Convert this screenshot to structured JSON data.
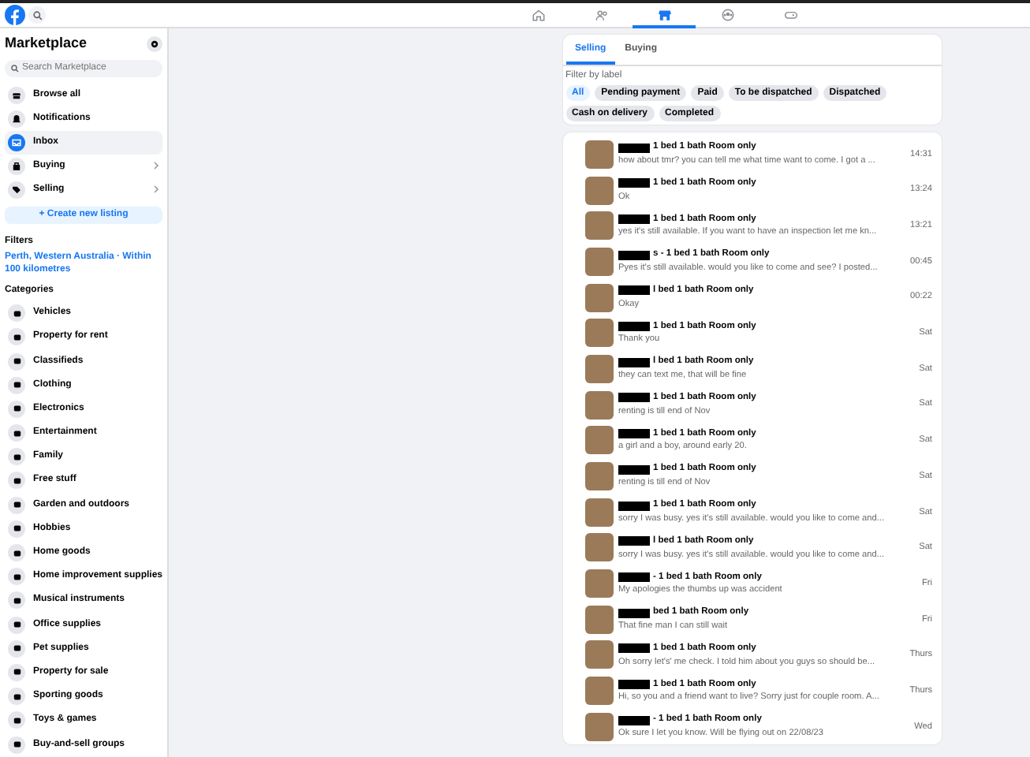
{
  "top_nav": [
    {
      "kind": "home",
      "selected": false
    },
    {
      "kind": "friends",
      "selected": false
    },
    {
      "kind": "marketplace",
      "selected": true
    },
    {
      "kind": "groups",
      "selected": false
    },
    {
      "kind": "gaming",
      "selected": false
    }
  ],
  "sidebar": {
    "title": "Marketplace",
    "search": {
      "placeholder": "Search Marketplace"
    },
    "items": [
      {
        "kind": "shop",
        "label": "Browse all",
        "selected": false,
        "has_arrow": false
      },
      {
        "kind": "bell",
        "label": "Notifications",
        "selected": false,
        "has_arrow": false
      },
      {
        "kind": "inbox",
        "label": "Inbox",
        "selected": true,
        "has_arrow": false
      },
      {
        "kind": "bag",
        "label": "Buying",
        "selected": false,
        "has_arrow": true
      },
      {
        "kind": "tag",
        "label": "Selling",
        "selected": false,
        "has_arrow": true
      }
    ],
    "create_button": "+ Create new listing",
    "filters_heading": "Filters",
    "location": "Perth, Western Australia · Within 100 kilometres",
    "categories_heading": "Categories",
    "categories": [
      "Vehicles",
      "Property for rent",
      "Classifieds",
      "Clothing",
      "Electronics",
      "Entertainment",
      "Family",
      "Free stuff",
      "Garden and outdoors",
      "Hobbies",
      "Home goods",
      "Home improvement supplies",
      "Musical instruments",
      "Office supplies",
      "Pet supplies",
      "Property for sale",
      "Sporting goods",
      "Toys & games",
      "Buy-and-sell groups"
    ]
  },
  "tabs": [
    {
      "label": "Selling",
      "selected": true
    },
    {
      "label": "Buying",
      "selected": false
    }
  ],
  "filter_label": "Filter by label",
  "chips": [
    {
      "label": "All",
      "selected": true
    },
    {
      "label": "Pending payment",
      "selected": false
    },
    {
      "label": "Paid",
      "selected": false
    },
    {
      "label": "To be dispatched",
      "selected": false
    },
    {
      "label": "Dispatched",
      "selected": false
    },
    {
      "label": "Cash on delivery",
      "selected": false
    },
    {
      "label": "Completed",
      "selected": false
    }
  ],
  "messages": [
    {
      "title": "1 bed 1 bath Room only",
      "preview": "how about tmr? you can tell me what time want to come. I got a ...",
      "time": "14:31"
    },
    {
      "title": "1 bed 1 bath Room only",
      "preview": "Ok",
      "time": "13:24"
    },
    {
      "title": "1 bed 1 bath Room only",
      "preview": "yes it's still available. If you want to have an inspection let me kn...",
      "time": "13:21"
    },
    {
      "title": "s - 1 bed 1 bath Room only",
      "preview": "Pyes it's still available. would you like to come and see? I posted...",
      "time": "00:45"
    },
    {
      "title": "l bed 1 bath Room only",
      "preview": "Okay",
      "time": "00:22"
    },
    {
      "title": "1 bed 1 bath Room only",
      "preview": "Thank you",
      "time": "Sat"
    },
    {
      "title": "l bed 1 bath Room only",
      "preview": "they can text me, that will be fine",
      "time": "Sat"
    },
    {
      "title": "1 bed 1 bath Room only",
      "preview": "renting is till end of Nov",
      "time": "Sat"
    },
    {
      "title": "1 bed 1 bath Room only",
      "preview": "a girl and a boy, around early 20.",
      "time": "Sat"
    },
    {
      "title": "1 bed 1 bath Room only",
      "preview": "renting is till end of Nov",
      "time": "Sat"
    },
    {
      "title": "1 bed 1 bath Room only",
      "preview": "sorry I was busy. yes it's still available. would you like to come and...",
      "time": "Sat"
    },
    {
      "title": "l bed 1 bath Room only",
      "preview": "sorry I was busy. yes it's still available. would you like to come and...",
      "time": "Sat"
    },
    {
      "title": "- 1 bed 1 bath Room only",
      "preview": "My apologies the thumbs up was accident",
      "time": "Fri"
    },
    {
      "title": "bed 1 bath Room only",
      "preview": "That fine man I can still wait",
      "time": "Fri"
    },
    {
      "title": "1 bed 1 bath Room only",
      "preview": "Oh sorry let's' me check. I told him about you guys so should be...",
      "time": "Thurs"
    },
    {
      "title": "1 bed 1 bath Room only",
      "preview": "Hi, so you and a friend want to live? Sorry just for couple room. A...",
      "time": "Thurs"
    },
    {
      "title": "- 1 bed 1 bath Room only",
      "preview": "Ok sure I let you know. Will be flying out on 22/08/23",
      "time": "Wed"
    }
  ]
}
